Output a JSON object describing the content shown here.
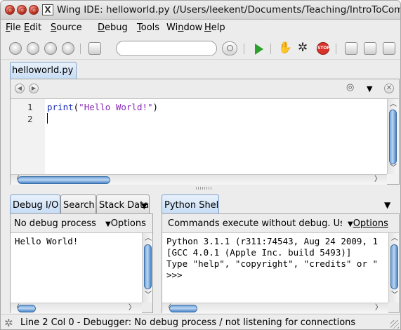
{
  "window": {
    "title": "Wing IDE: helloworld.py (/Users/leekent/Documents/Teaching/IntroToComp"
  },
  "menubar": [
    {
      "underlined": "F",
      "rest": "ile"
    },
    {
      "underlined": "E",
      "rest": "dit"
    },
    {
      "underlined": "S",
      "rest": "ource"
    },
    {
      "underlined": "D",
      "rest": "ebug"
    },
    {
      "underlined": "T",
      "rest": "ools"
    },
    {
      "prefix": "Wi",
      "underlined": "n",
      "rest": "dow"
    },
    {
      "underlined": "H",
      "rest": "elp"
    }
  ],
  "toolbar": {
    "search_value": "",
    "icons": [
      "new-file-icon",
      "open-file-icon",
      "save-icon",
      "save-all-icon",
      "print-icon",
      "search-icon",
      "run-icon",
      "stop-hand-icon",
      "debug-bug-icon",
      "stop-sign-icon",
      "indent-icon",
      "outdent-icon",
      "comment-icon"
    ]
  },
  "editor": {
    "tab_label": "helloworld.py",
    "line_numbers": [
      "1",
      "2"
    ],
    "code": {
      "func": "print",
      "open": "(",
      "string": "\"Hello World!\"",
      "close": ")"
    }
  },
  "debug_panel": {
    "tabs": [
      "Debug I/O",
      "Search",
      "Stack Data"
    ],
    "status": "No debug process",
    "options_label": "Options",
    "output": [
      "Hello World!"
    ]
  },
  "shell_panel": {
    "tab_label": "Python Shell",
    "status": "Commands execute without debug.  Us",
    "options_label": "Options",
    "output": [
      "Python 3.1.1 (r311:74543, Aug 24 2009, 1",
      "[GCC 4.0.1 (Apple Inc. build 5493)]",
      "Type \"help\", \"copyright\", \"credits\" or \"",
      ">>>"
    ]
  },
  "statusbar": {
    "text": "Line 2 Col 0 - Debugger: No debug process / not listening for connections"
  }
}
